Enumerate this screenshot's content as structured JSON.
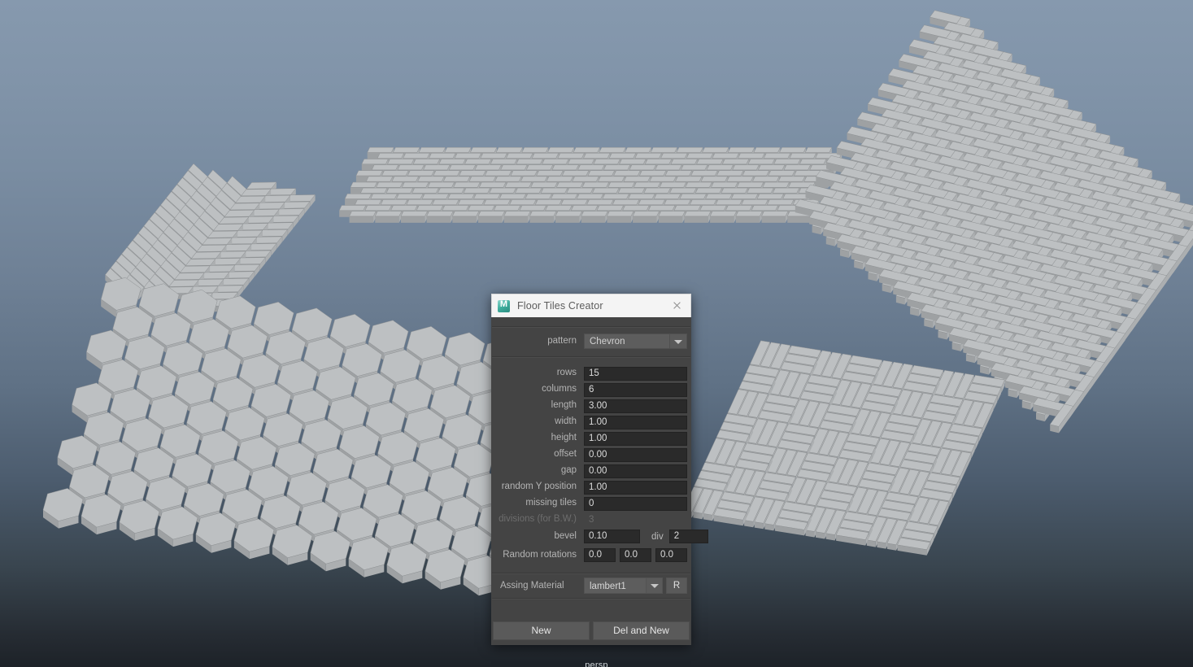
{
  "viewport": {
    "camera_label": "persp",
    "background_top_color": "#8699ae",
    "background_bottom_color": "#1d2228",
    "tile_color": "#b9bcbe",
    "patterns_shown": [
      {
        "name": "chevron",
        "position": "top-left"
      },
      {
        "name": "running-bond-brick",
        "position": "top-center"
      },
      {
        "name": "herringbone",
        "position": "top-right"
      },
      {
        "name": "hexagon",
        "position": "bottom-left"
      },
      {
        "name": "basketweave",
        "position": "bottom-right"
      }
    ]
  },
  "dialog": {
    "title": "Floor Tiles Creator",
    "app_icon": "maya-m-icon",
    "close_icon": "close-icon",
    "pattern": {
      "label": "pattern",
      "value": "Chevron",
      "dropdown_icon": "chevron-down-icon"
    },
    "fields": [
      {
        "label": "rows",
        "value": "15",
        "disabled": false
      },
      {
        "label": "columns",
        "value": "6",
        "disabled": false
      },
      {
        "label": "length",
        "value": "3.00",
        "disabled": false
      },
      {
        "label": "width",
        "value": "1.00",
        "disabled": false
      },
      {
        "label": "height",
        "value": "1.00",
        "disabled": false
      },
      {
        "label": "offset",
        "value": "0.00",
        "disabled": false
      },
      {
        "label": "gap",
        "value": "0.00",
        "disabled": false
      },
      {
        "label": "random Y position",
        "value": "1.00",
        "disabled": false
      },
      {
        "label": "missing tiles",
        "value": "0",
        "disabled": false
      },
      {
        "label": "divisions (for B.W.)",
        "value": "3",
        "disabled": true
      }
    ],
    "bevel": {
      "label": "bevel",
      "value": "0.10",
      "div_label": "div",
      "div_value": "2"
    },
    "random_rotations": {
      "label": "Random rotations",
      "values": [
        "0.0",
        "0.0",
        "0.0"
      ]
    },
    "material": {
      "label": "Assing Material",
      "value": "lambert1",
      "dropdown_icon": "chevron-down-icon",
      "reset_button": "R"
    },
    "buttons": {
      "new": "New",
      "del_and_new": "Del and New"
    }
  }
}
